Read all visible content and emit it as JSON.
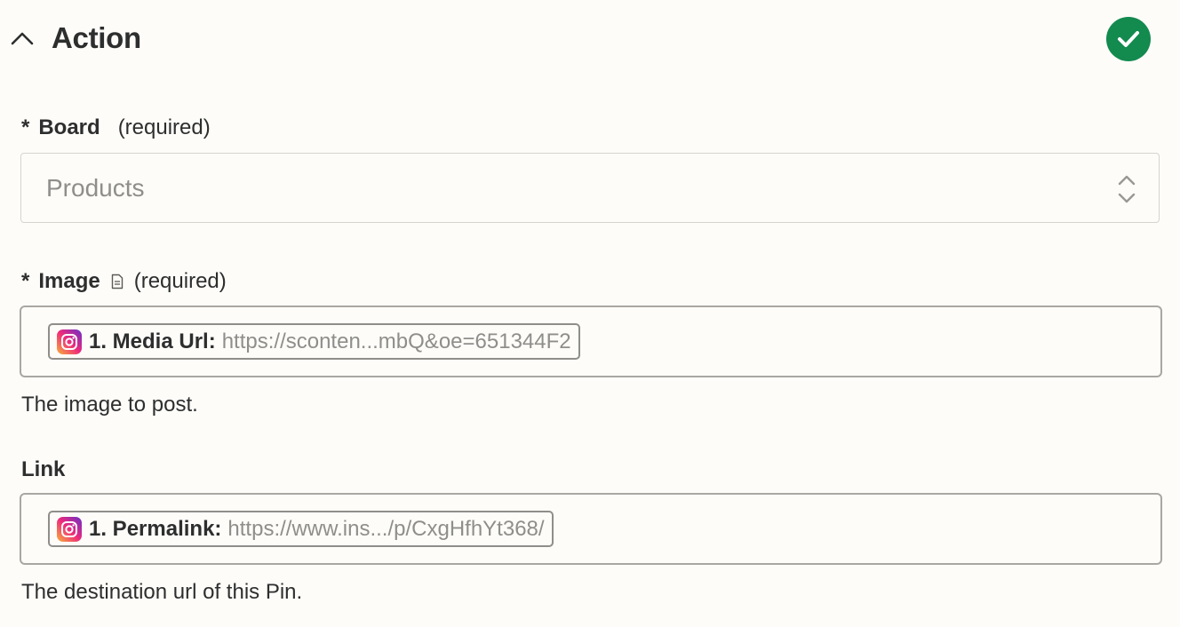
{
  "section": {
    "title": "Action",
    "status_color": "#138a4e"
  },
  "fields": {
    "board": {
      "star": "*",
      "label": "Board",
      "required_text": "(required)",
      "value": "Products"
    },
    "image": {
      "star": "*",
      "label": "Image",
      "required_text": "(required)",
      "token_icon": "instagram-icon",
      "token_label": "1. Media Url:",
      "token_value": "https://sconten...mbQ&oe=651344F2",
      "help": "The image to post."
    },
    "link": {
      "label": "Link",
      "token_icon": "instagram-icon",
      "token_label": "1. Permalink:",
      "token_value": "https://www.ins.../p/CxgHfhYt368/",
      "help": "The destination url of this Pin."
    }
  }
}
